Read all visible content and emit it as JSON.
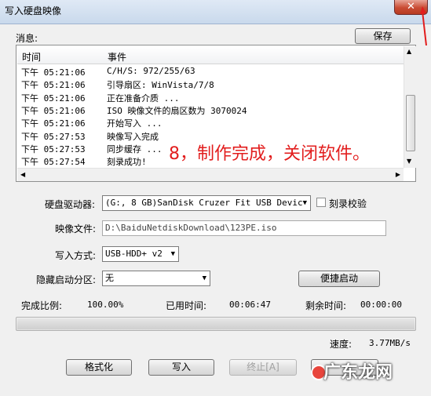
{
  "window": {
    "title": "写入硬盘映像",
    "close_glyph": "✕"
  },
  "log": {
    "label": "消息:",
    "save_label": "保存",
    "columns": [
      "时间",
      "事件"
    ],
    "rows": [
      {
        "time": "下午 05:21:06",
        "event": "C/H/S: 972/255/63"
      },
      {
        "time": "下午 05:21:06",
        "event": "引导扇区: WinVista/7/8"
      },
      {
        "time": "下午 05:21:06",
        "event": "正在准备介质 ..."
      },
      {
        "time": "下午 05:21:06",
        "event": "ISO 映像文件的扇区数为 3070024"
      },
      {
        "time": "下午 05:21:06",
        "event": "开始写入 ..."
      },
      {
        "time": "下午 05:27:53",
        "event": "映像写入完成"
      },
      {
        "time": "下午 05:27:53",
        "event": "同步缓存 ..."
      },
      {
        "time": "下午 05:27:54",
        "event": "刻录成功!"
      }
    ]
  },
  "annotation": "8，制作完成，关闭软件。",
  "form": {
    "drive_label": "硬盘驱动器:",
    "drive_value": "(G:, 8 GB)SanDisk Cruzer Fit USB Devic",
    "verify_label": "刻录校验",
    "image_label": "映像文件:",
    "image_value": "D:\\BaiduNetdiskDownload\\123PE.iso",
    "method_label": "写入方式:",
    "method_value": "USB-HDD+ v2",
    "hidden_label": "隐藏启动分区:",
    "hidden_value": "无",
    "quick_boot_label": "便捷启动"
  },
  "status": {
    "complete_label": "完成比例:",
    "complete_value": "100.00%",
    "elapsed_label": "已用时间:",
    "elapsed_value": "00:06:47",
    "remaining_label": "剩余时间:",
    "remaining_value": "00:00:00",
    "progress_fraction": 1.0,
    "speed_label": "速度:",
    "speed_value": "3.77MB/s"
  },
  "buttons": {
    "format": "格式化",
    "write": "写入",
    "stop": "终止[A]"
  },
  "watermark": "广东龙网"
}
